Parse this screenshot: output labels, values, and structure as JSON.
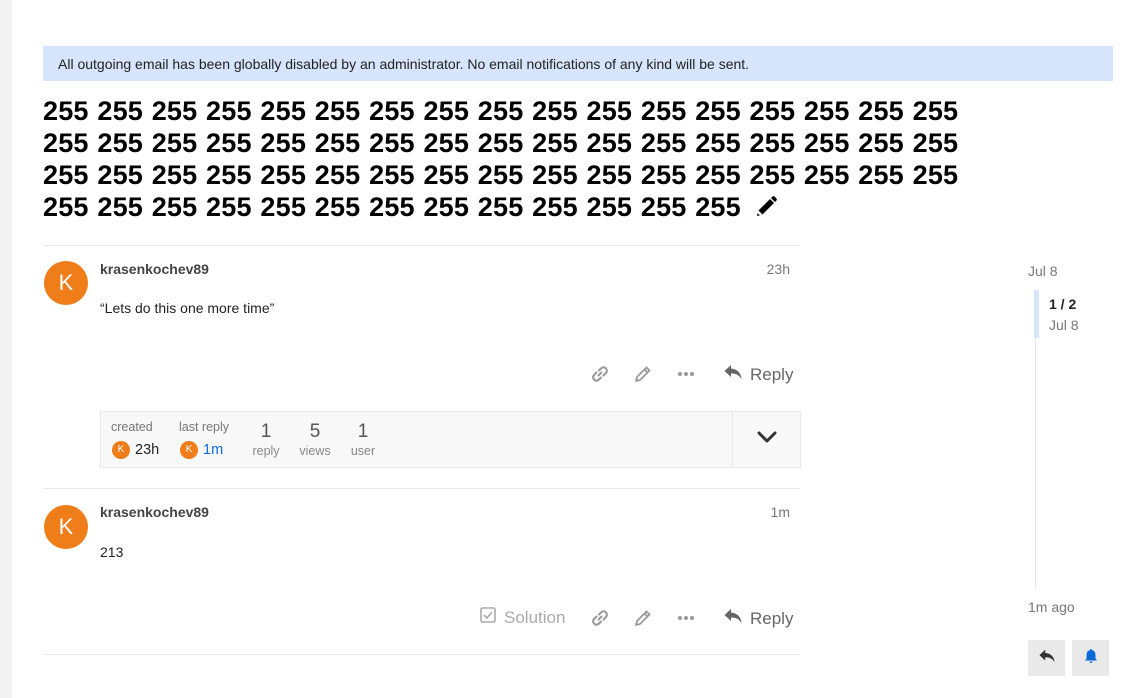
{
  "banner": {
    "text": "All outgoing email has been globally disabled by an administrator. No email notifications of any kind will be sent."
  },
  "topic": {
    "title": "255 255 255 255 255 255 255 255 255 255 255 255 255 255 255 255 255 255 255 255 255 255 255 255 255 255 255 255 255 255 255 255 255 255 255 255 255 255 255 255 255 255 255 255 255 255 255 255 255 255 255 255 255 255 255 255 255 255 255 255 255 255 255 255",
    "edit_icon": "pencil-icon"
  },
  "posts": [
    {
      "avatar_letter": "K",
      "username": "krasenkochev89",
      "date": "23h",
      "body": "“Lets do this one more time”",
      "reply_label": "Reply"
    },
    {
      "avatar_letter": "K",
      "username": "krasenkochev89",
      "date": "1m",
      "body": "213",
      "solution_label": "Solution",
      "reply_label": "Reply"
    }
  ],
  "topic_map": {
    "created_label": "created",
    "created_avatar": "K",
    "created_value": "23h",
    "last_reply_label": "last reply",
    "last_reply_avatar": "K",
    "last_reply_value": "1m",
    "replies_count": "1",
    "replies_label": "reply",
    "views_count": "5",
    "views_label": "views",
    "users_count": "1",
    "users_label": "user"
  },
  "timeline": {
    "start_date": "Jul 8",
    "position": "1 / 2",
    "position_date": "Jul 8",
    "end_label": "1m ago"
  },
  "colors": {
    "accent": "#ee7d1a",
    "banner_bg": "#d6e5fb",
    "link": "#0a6bd8"
  }
}
